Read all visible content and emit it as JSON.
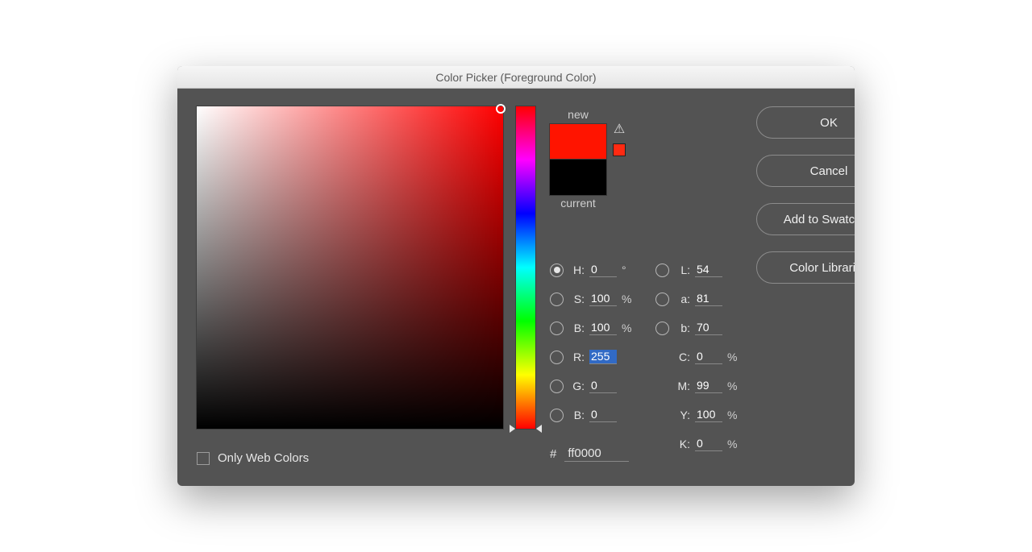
{
  "window": {
    "title": "Color Picker (Foreground Color)"
  },
  "buttons": {
    "ok": "OK",
    "cancel": "Cancel",
    "add_swatches": "Add to Swatches",
    "color_libraries": "Color Libraries"
  },
  "preview": {
    "new_label": "new",
    "current_label": "current",
    "new_color": "#ff1400",
    "current_color": "#000000"
  },
  "only_web_colors": {
    "label": "Only Web Colors",
    "checked": false
  },
  "fields": {
    "hsb": {
      "H": {
        "label": "H:",
        "value": "0",
        "unit": "°",
        "selected": true
      },
      "S": {
        "label": "S:",
        "value": "100",
        "unit": "%"
      },
      "B": {
        "label": "B:",
        "value": "100",
        "unit": "%"
      }
    },
    "rgb": {
      "R": {
        "label": "R:",
        "value": "255",
        "highlighted": true
      },
      "G": {
        "label": "G:",
        "value": "0"
      },
      "B": {
        "label": "B:",
        "value": "0"
      }
    },
    "lab": {
      "L": {
        "label": "L:",
        "value": "54"
      },
      "a": {
        "label": "a:",
        "value": "81"
      },
      "b": {
        "label": "b:",
        "value": "70"
      }
    },
    "cmyk": {
      "C": {
        "label": "C:",
        "value": "0",
        "unit": "%"
      },
      "M": {
        "label": "M:",
        "value": "99",
        "unit": "%"
      },
      "Y": {
        "label": "Y:",
        "value": "100",
        "unit": "%"
      },
      "K": {
        "label": "K:",
        "value": "0",
        "unit": "%"
      }
    },
    "hex": {
      "label": "#",
      "value": "ff0000"
    }
  }
}
